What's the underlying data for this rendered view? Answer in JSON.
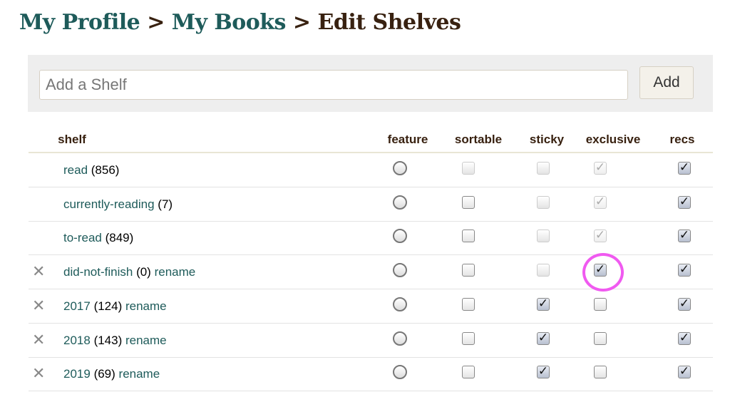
{
  "breadcrumb": {
    "items": [
      "My Profile",
      "My Books"
    ],
    "separator": ">",
    "current": "Edit Shelves"
  },
  "add_shelf": {
    "placeholder": "Add a Shelf",
    "value": "",
    "button": "Add"
  },
  "columns": [
    "shelf",
    "feature",
    "sortable",
    "sticky",
    "exclusive",
    "recs"
  ],
  "rename_label": "rename",
  "colors": {
    "link": "#1e5b5a",
    "heading": "#382110",
    "highlight_ring": "#f05af0"
  },
  "rows": [
    {
      "name": "read",
      "count": "(856)",
      "deletable": false,
      "renamable": false,
      "feature": false,
      "sortable": {
        "checked": false,
        "disabled": true
      },
      "sticky": {
        "checked": false,
        "disabled": true
      },
      "exclusive": {
        "checked": true,
        "disabled": true
      },
      "recs": {
        "checked": true,
        "disabled": false
      }
    },
    {
      "name": "currently-reading",
      "count": "(7)",
      "deletable": false,
      "renamable": false,
      "feature": false,
      "sortable": {
        "checked": false,
        "disabled": false
      },
      "sticky": {
        "checked": false,
        "disabled": true
      },
      "exclusive": {
        "checked": true,
        "disabled": true
      },
      "recs": {
        "checked": true,
        "disabled": false
      }
    },
    {
      "name": "to-read",
      "count": "(849)",
      "deletable": false,
      "renamable": false,
      "feature": false,
      "sortable": {
        "checked": false,
        "disabled": false
      },
      "sticky": {
        "checked": false,
        "disabled": true
      },
      "exclusive": {
        "checked": true,
        "disabled": true
      },
      "recs": {
        "checked": true,
        "disabled": false
      }
    },
    {
      "name": "did-not-finish",
      "count": "(0)",
      "deletable": true,
      "renamable": true,
      "feature": false,
      "sortable": {
        "checked": false,
        "disabled": false
      },
      "sticky": {
        "checked": false,
        "disabled": true
      },
      "exclusive": {
        "checked": true,
        "disabled": false,
        "highlighted": true
      },
      "recs": {
        "checked": true,
        "disabled": false
      }
    },
    {
      "name": "2017",
      "count": "(124)",
      "deletable": true,
      "renamable": true,
      "feature": false,
      "sortable": {
        "checked": false,
        "disabled": false
      },
      "sticky": {
        "checked": true,
        "disabled": false
      },
      "exclusive": {
        "checked": false,
        "disabled": false
      },
      "recs": {
        "checked": true,
        "disabled": false
      }
    },
    {
      "name": "2018",
      "count": "(143)",
      "deletable": true,
      "renamable": true,
      "feature": false,
      "sortable": {
        "checked": false,
        "disabled": false
      },
      "sticky": {
        "checked": true,
        "disabled": false
      },
      "exclusive": {
        "checked": false,
        "disabled": false
      },
      "recs": {
        "checked": true,
        "disabled": false
      }
    },
    {
      "name": "2019",
      "count": "(69)",
      "deletable": true,
      "renamable": true,
      "feature": false,
      "sortable": {
        "checked": false,
        "disabled": false
      },
      "sticky": {
        "checked": true,
        "disabled": false
      },
      "exclusive": {
        "checked": false,
        "disabled": false
      },
      "recs": {
        "checked": true,
        "disabled": false
      }
    }
  ]
}
